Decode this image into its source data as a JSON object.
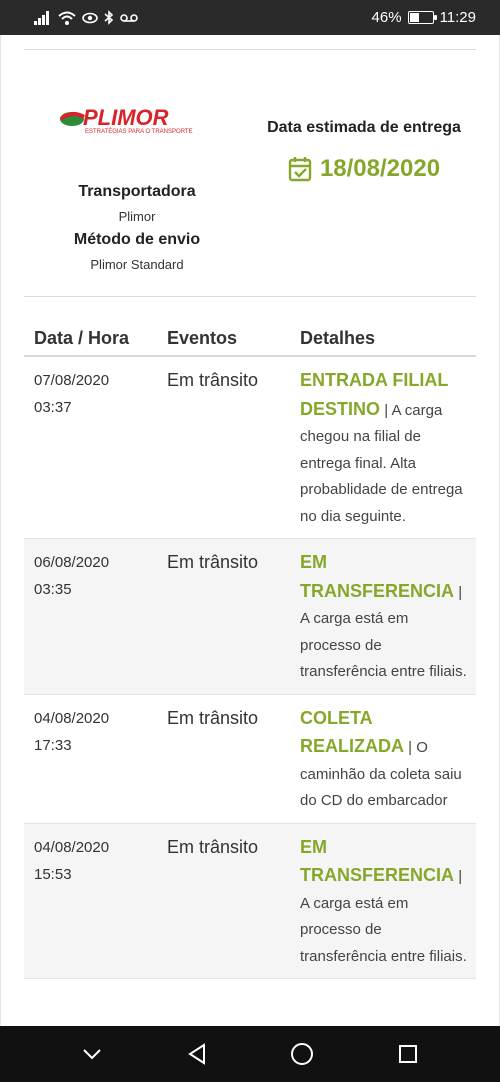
{
  "status_bar": {
    "battery": "46%",
    "battery_fraction": 0.46,
    "time": "11:29",
    "icons": [
      "signal-icon",
      "wifi-icon",
      "eye-icon",
      "bluetooth-icon",
      "voicemail-icon"
    ]
  },
  "carrier": {
    "logo_text": "PLIMOR",
    "logo_tagline": "ESTRATÉGIAS PARA O TRANSPORTE",
    "carrier_label": "Transportadora",
    "carrier_value": "Plimor",
    "method_label": "Método de envio",
    "method_value": "Plimor Standard"
  },
  "estimate": {
    "title": "Data estimada de entrega",
    "date": "18/08/2020",
    "icon": "calendar-check-icon"
  },
  "table": {
    "headers": [
      "Data / Hora",
      "Eventos",
      "Detalhes"
    ],
    "rows": [
      {
        "date": "07/08/2020",
        "time": "03:37",
        "status": "Em trânsito",
        "event": "ENTRADA FILIAL DESTINO",
        "separator": "|",
        "detail": "A carga chegou na filial de entrega final. Alta probablidade de entrega no dia seguinte."
      },
      {
        "date": "06/08/2020",
        "time": "03:35",
        "status": "Em trânsito",
        "event": "EM TRANSFERENCIA",
        "separator": "|",
        "detail": "A carga está em processo de transferência entre filiais."
      },
      {
        "date": "04/08/2020",
        "time": "17:33",
        "status": "Em trânsito",
        "event": "COLETA REALIZADA",
        "separator": "|",
        "detail": "O caminhão da coleta saiu do CD do embarcador"
      },
      {
        "date": "04/08/2020",
        "time": "15:53",
        "status": "Em trânsito",
        "event": "EM TRANSFERENCIA",
        "separator": "|",
        "detail": "A carga está em processo de transferência entre filiais."
      }
    ]
  },
  "colors": {
    "accent_green": "#86a82a",
    "logo_red": "#d8232a",
    "logo_green": "#2e8b3a"
  }
}
